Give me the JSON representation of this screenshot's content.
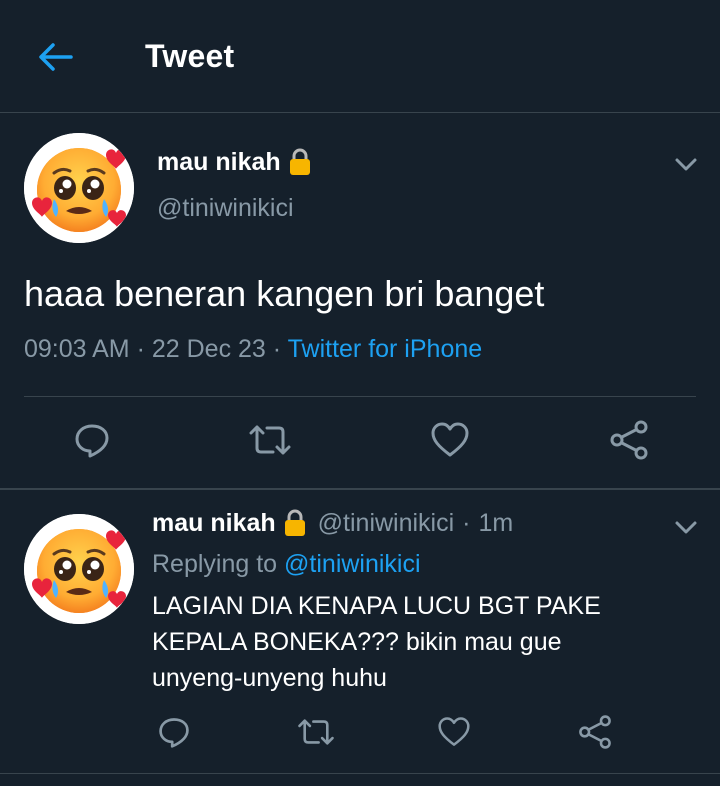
{
  "header": {
    "title": "Tweet",
    "back_icon": "arrow-left-icon"
  },
  "colors": {
    "background": "#15202b",
    "divider": "#38444d",
    "secondary_text": "#8899a6",
    "accent": "#1da1f2"
  },
  "main_tweet": {
    "author_name": "mau nikah",
    "author_handle": "@tiniwinikici",
    "text": "haaa beneran kangen bri banget",
    "time": "09:03 AM",
    "date": "22 Dec 23",
    "separator": "·",
    "source": "Twitter for iPhone",
    "actions": [
      "reply-icon",
      "retweet-icon",
      "like-icon",
      "share-icon"
    ]
  },
  "reply_tweet": {
    "author_name": "mau nikah",
    "author_handle": "@tiniwinikici",
    "separator": "·",
    "age": "1m",
    "replying_to_label": "Replying to",
    "replying_to_handle": "@tiniwinikici",
    "text_lines": [
      "LAGIAN DIA KENAPA LUCU BGT PAKE",
      "KEPALA BONEKA??? bikin mau gue",
      "unyeng-unyeng huhu"
    ],
    "actions": [
      "reply-icon",
      "retweet-icon",
      "like-icon",
      "share-icon"
    ]
  }
}
